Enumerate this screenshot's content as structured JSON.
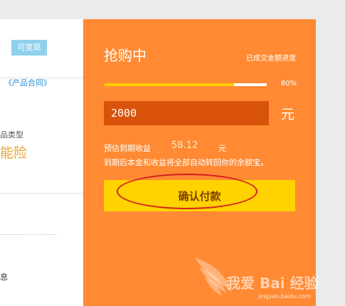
{
  "left": {
    "tag": "可变现",
    "contract_link": "《产品合同》",
    "product_type_label": "品类型",
    "product_type_value": "能险",
    "info_fragment": "息"
  },
  "panel": {
    "title": "抢购中",
    "progress_caption": "已成交金额进度",
    "progress_percent": "80%",
    "progress_fraction": 0.8,
    "amount_value": "2000",
    "unit": "元",
    "expected_label": "预估到期收益",
    "expected_value": "58.12",
    "expected_unit": "元",
    "notice": "到期后本金和收益将全部自动转回你的余额宝。",
    "confirm_label": "确认付款"
  },
  "watermark": {
    "text": "我爱 Bai 经验",
    "url": "jingyan.baidu.com"
  },
  "colors": {
    "panel_bg": "#ff8a33",
    "input_bg": "#d9520a",
    "button_bg": "#ffd200",
    "progress_fill": "#ffcc00",
    "highlight": "#d42020",
    "tag_bg": "#8fd0ec"
  }
}
